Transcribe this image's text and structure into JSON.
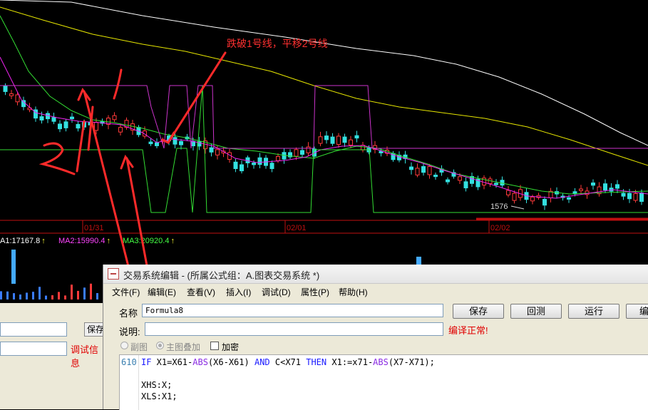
{
  "chart": {
    "annotation": "跌破1号线，平移2号线",
    "price_label": "1576",
    "dates": [
      "01/31",
      "02/01",
      "02/02"
    ],
    "ma": [
      {
        "label": "A1:17167.8",
        "arrow": "↑",
        "color": "#ffffff"
      },
      {
        "label": "MA2:15990.4",
        "arrow": "↑",
        "color": "#ff44ff"
      },
      {
        "label": "MA3:20920.4",
        "arrow": "↑",
        "color": "#44ff44"
      }
    ],
    "handwritten": [
      "1",
      "2"
    ]
  },
  "back_panel": {
    "save_label": "保存",
    "debug_info": "调试信息"
  },
  "dialog": {
    "title": "交易系统编辑 - (所属公式组：A.图表交易系统 *)",
    "menu": [
      "文件(F)",
      "编辑(E)",
      "查看(V)",
      "插入(I)",
      "调试(D)",
      "属性(P)",
      "帮助(H)"
    ],
    "name_label": "名称",
    "name_value": "Formula8",
    "desc_label": "说明",
    "desc_value": "",
    "buttons": [
      "保存",
      "回测",
      "运行",
      "编"
    ],
    "compile_status": "编译正常!",
    "option_sub": "副图",
    "option_main": "主图叠加",
    "option_encrypt": "加密",
    "line_number": "610",
    "code_lines": [
      "IF X1=X61-ABS(X6-X61) AND C<X71 THEN X1:=x71-ABS(X7-X71);",
      "",
      "XHS:X;",
      "XLS:X1;"
    ]
  }
}
